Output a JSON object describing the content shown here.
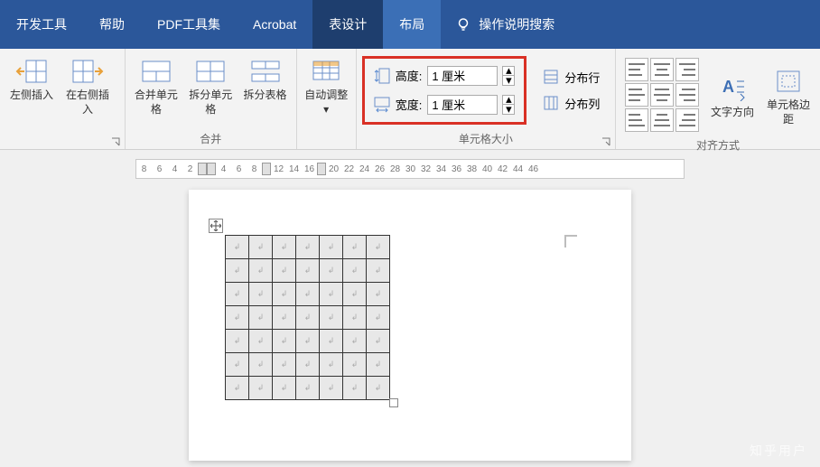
{
  "tabs": {
    "dev": "开发工具",
    "help": "帮助",
    "pdf": "PDF工具集",
    "acrobat": "Acrobat",
    "design": "表设计",
    "layout": "布局",
    "tellme": "操作说明搜索"
  },
  "ribbon": {
    "insert": {
      "left": "左侧插入",
      "right": "在右侧插入"
    },
    "merge": {
      "merge": "合并单元格",
      "splitcell": "拆分单元格",
      "splittbl": "拆分表格",
      "group": "合并"
    },
    "autofit": {
      "label": "自动调整"
    },
    "cellsize": {
      "hlabel": "高度:",
      "hval": "1 厘米",
      "wlabel": "宽度:",
      "wval": "1 厘米",
      "group": "单元格大小"
    },
    "dist": {
      "rows": "分布行",
      "cols": "分布列"
    },
    "textdir": "文字方向",
    "cellmargin": "单元格边距",
    "aligngroup": "对齐方式"
  },
  "ruler": [
    "8",
    "6",
    "4",
    "2",
    "",
    "",
    "4",
    "6",
    "8",
    "",
    "12",
    "14",
    "16",
    "",
    "20",
    "22",
    "24",
    "26",
    "28",
    "30",
    "32",
    "34",
    "36",
    "38",
    "40",
    "42",
    "44",
    "46"
  ],
  "watermark": "知乎用户"
}
